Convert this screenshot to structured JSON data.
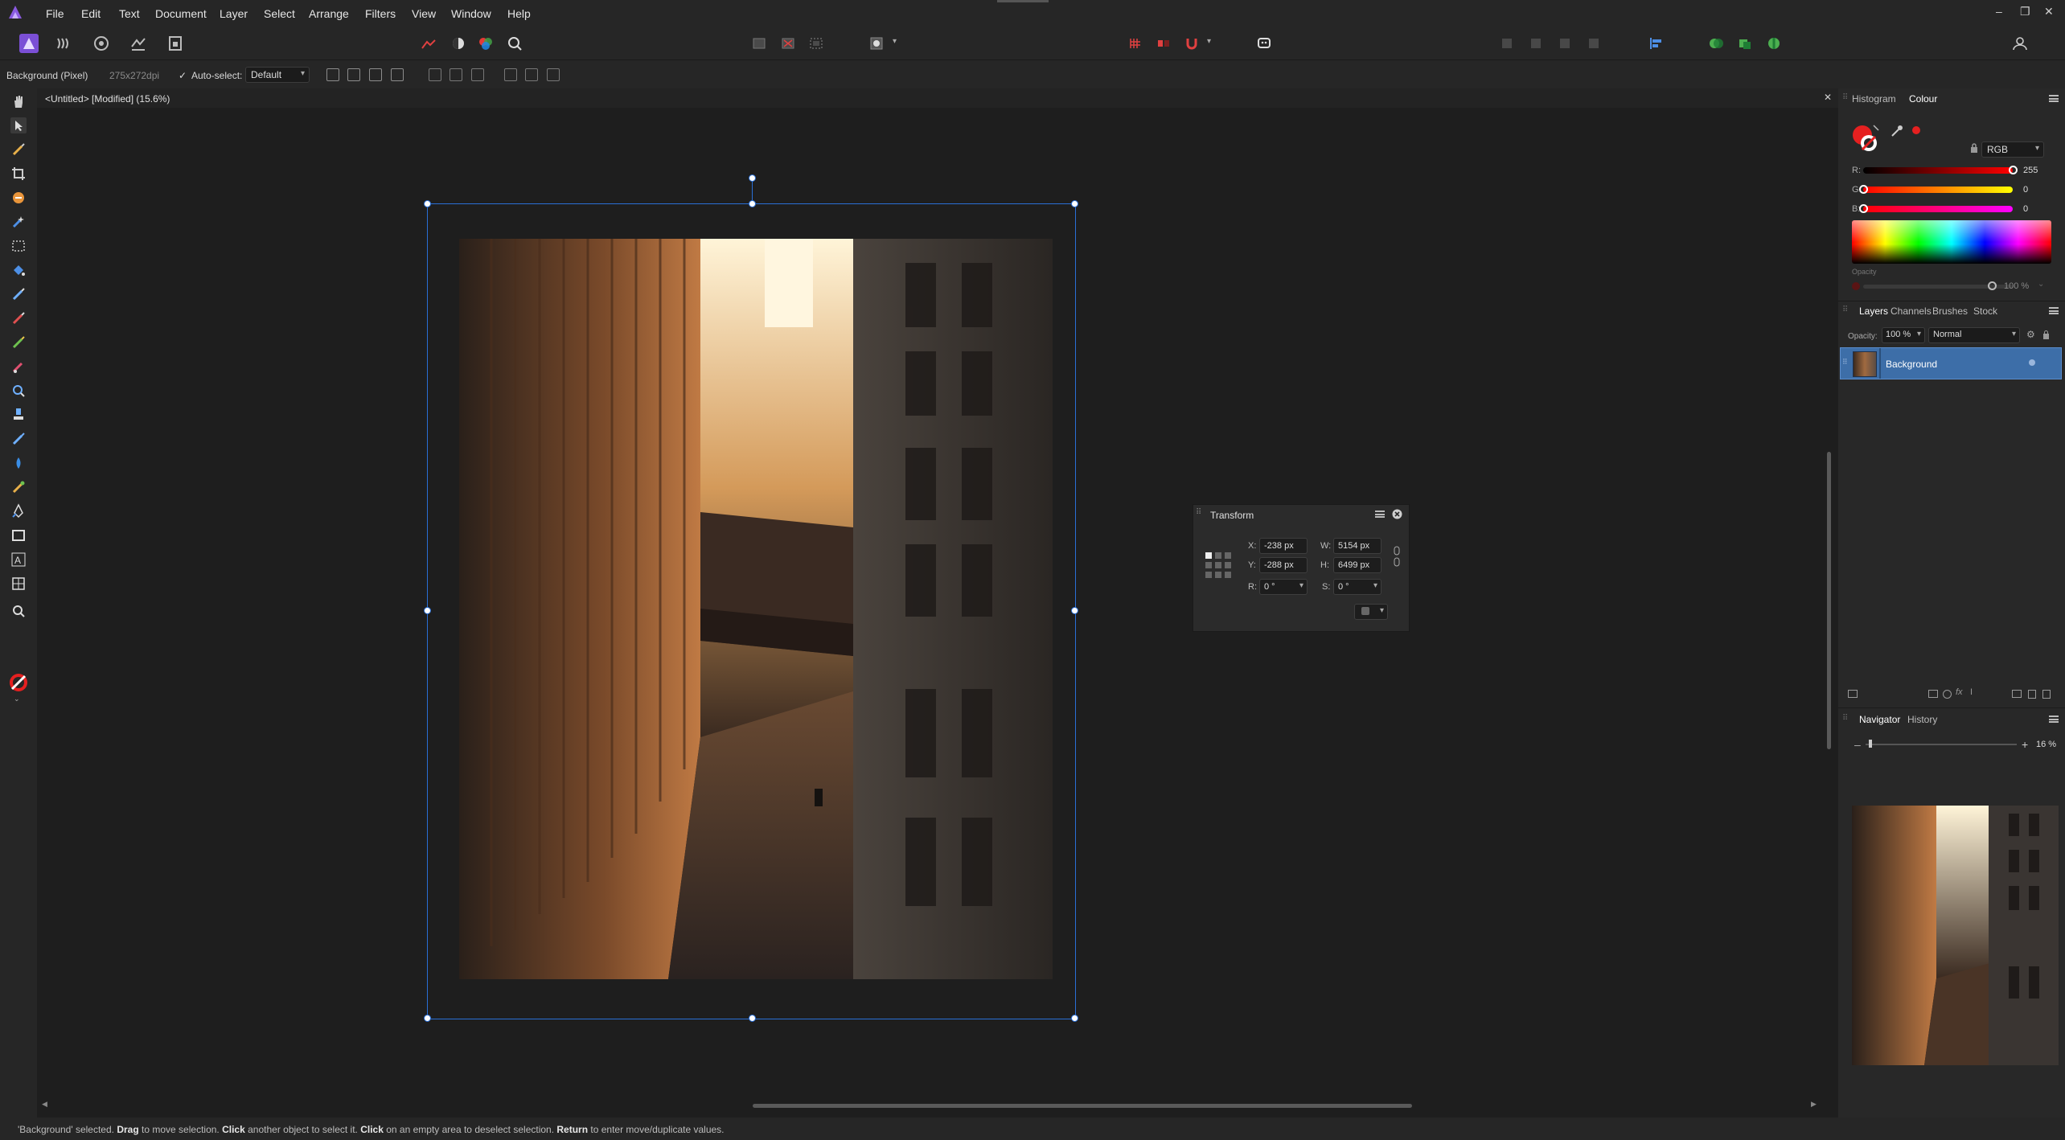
{
  "menu": [
    "File",
    "Edit",
    "Text",
    "Document",
    "Layer",
    "Select",
    "Arrange",
    "Filters",
    "View",
    "Window",
    "Help"
  ],
  "window_controls": [
    "–",
    "❐",
    "✕"
  ],
  "context": {
    "layer_label": "Background (Pixel)",
    "dpi": "275x272dpi",
    "auto_select_label": "Auto-select:",
    "auto_select_value": "Default"
  },
  "document": {
    "tab_title": "<Untitled> [Modified] (15.6%)",
    "close": "✕"
  },
  "panels": {
    "top_tabs": [
      "Histogram",
      "Colour"
    ],
    "colour": {
      "model": "RGB",
      "r_label": "R:",
      "r_value": "255",
      "r": 255,
      "g_label": "G:",
      "g_value": "0",
      "g": 0,
      "b_label": "B:",
      "b_value": "0",
      "b": 0,
      "opacity_label": "Opacity",
      "opacity_value": "100 %"
    },
    "layers_tabs": [
      "Layers",
      "Channels",
      "Brushes",
      "Stock"
    ],
    "layers": {
      "opacity_label": "Opacity:",
      "opacity_value": "100 %",
      "blend_mode": "Normal",
      "items": [
        {
          "name": "Background"
        }
      ]
    },
    "nav_tabs": [
      "Navigator",
      "History"
    ],
    "navigator": {
      "zoom": "16 %",
      "minus": "–",
      "plus": "+"
    }
  },
  "transform": {
    "title": "Transform",
    "x_label": "X:",
    "x": "-238 px",
    "y_label": "Y:",
    "y": "-288 px",
    "w_label": "W:",
    "w": "5154 px",
    "h_label": "H:",
    "h": "6499 px",
    "r_label": "R:",
    "r": "0 °",
    "s_label": "S:",
    "s": "0 °"
  },
  "status": {
    "q1": "'Background' selected.",
    "b1": "Drag",
    "t1": "to move selection.",
    "b2": "Click",
    "t2": "another object to select it.",
    "b3": "Click",
    "t3": "on an empty area to deselect selection.",
    "b4": "Return",
    "t4": "to enter move/duplicate values."
  },
  "colors": {
    "accent": "#2a6fd6",
    "layer_selected": "#3d6ea8",
    "brand": "#7b4fd6",
    "foreground": "#e52020"
  }
}
